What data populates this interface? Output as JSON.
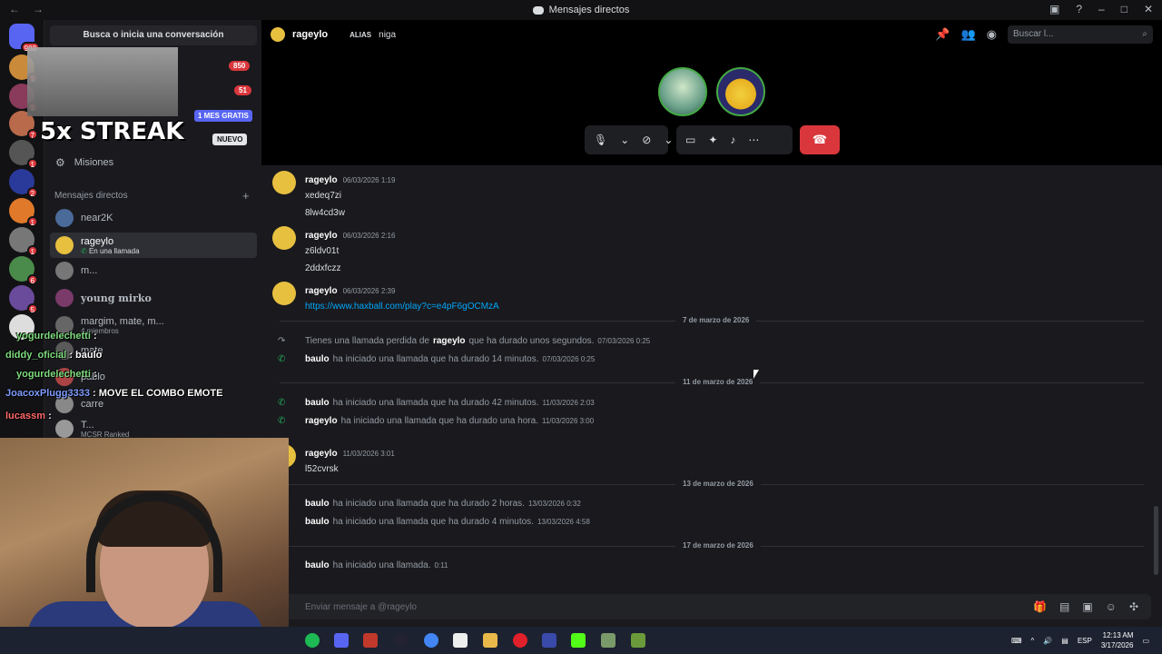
{
  "window": {
    "title": "Mensajes directos"
  },
  "sidebar": {
    "search_label": "Busca o inicia una conversación",
    "badge_850": "850",
    "badge_51": "51",
    "nitro_promo": "1 MES GRATIS",
    "new_pill": "NUEVO",
    "missions_label": "Misiones",
    "dm_header": "Mensajes directos",
    "dms": [
      {
        "name": "near2K",
        "sub": ""
      },
      {
        "name": "rageylo",
        "sub": "En una llamada"
      },
      {
        "name": "m...",
        "sub": ""
      },
      {
        "name": "young mirko",
        "sub": ""
      },
      {
        "name": "margim, mate, m...",
        "sub": "4 miembros"
      },
      {
        "name": "mate",
        "sub": ""
      },
      {
        "name": "pablo",
        "sub": ""
      },
      {
        "name": "carre",
        "sub": ""
      },
      {
        "name": "T...",
        "sub": "MCSR Ranked"
      }
    ]
  },
  "guild_badges": [
    "902",
    "1",
    "1",
    "7",
    "1",
    "2",
    "1",
    "1",
    "6",
    "5"
  ],
  "header": {
    "username": "rageylo",
    "alias_label": "ALIAS",
    "alias_value": "niga",
    "search_placeholder": "Buscar l..."
  },
  "messages": [
    {
      "author": "rageylo",
      "time": "06/03/2026 1:19",
      "lines": [
        "xedeq7zi",
        "8lw4cd3w"
      ]
    },
    {
      "author": "rageylo",
      "time": "06/03/2026 2:16",
      "lines": [
        "z6ldv01t",
        "2ddxfczz"
      ]
    },
    {
      "author": "rageylo",
      "time": "06/03/2026 2:39",
      "link": "https://www.haxball.com/play?c=e4pF6gOCMzA"
    },
    {
      "author": "rageylo",
      "time": "11/03/2026 3:01",
      "lines": [
        "l52cvrsk"
      ]
    }
  ],
  "dates": [
    "7 de marzo de 2026",
    "11 de marzo de 2026",
    "13 de marzo de 2026",
    "17 de marzo de 2026"
  ],
  "system": [
    {
      "pre": "Tienes una llamada perdida de",
      "who": "rageylo",
      "post": "que ha durado unos segundos.",
      "time": "07/03/2026 0:25"
    },
    {
      "who": "baulo",
      "post": "ha iniciado una llamada que ha durado 14 minutos.",
      "time": "07/03/2026 0:25"
    },
    {
      "who": "baulo",
      "post": "ha iniciado una llamada que ha durado 42 minutos.",
      "time": "11/03/2026 2:03"
    },
    {
      "who": "rageylo",
      "post": "ha iniciado una llamada que ha durado una hora.",
      "time": "11/03/2026 3:00"
    },
    {
      "who": "baulo",
      "post": "ha iniciado una llamada que ha durado 2 horas.",
      "time": "13/03/2026 0:32"
    },
    {
      "who": "baulo",
      "post": "ha iniciado una llamada que ha durado 4 minutos.",
      "time": "13/03/2026 4:58"
    },
    {
      "who": "baulo",
      "post": "ha iniciado una llamada.",
      "time": "0:11"
    }
  ],
  "composer": {
    "placeholder": "Enviar mensaje a @rageylo"
  },
  "overlay": {
    "streak": "5x STREAK",
    "chat": [
      {
        "user": "yogurdelechetti",
        "msg": ":"
      },
      {
        "user": "diddy_oficial",
        "msg": ": baulo"
      },
      {
        "user": "yogurdelechetti",
        "msg": ":"
      },
      {
        "user": "JoacoxPlugg3333",
        "msg": ": MOVE EL COMBO EMOTE"
      },
      {
        "user": "lucassm",
        "msg": ":"
      }
    ]
  },
  "taskbar": {
    "lang": "ESP",
    "time": "12:13 AM",
    "date": "3/17/2026"
  },
  "colors": {
    "accent": "#5865f2",
    "danger": "#da373c",
    "online": "#23a559",
    "link": "#00a8fc"
  }
}
